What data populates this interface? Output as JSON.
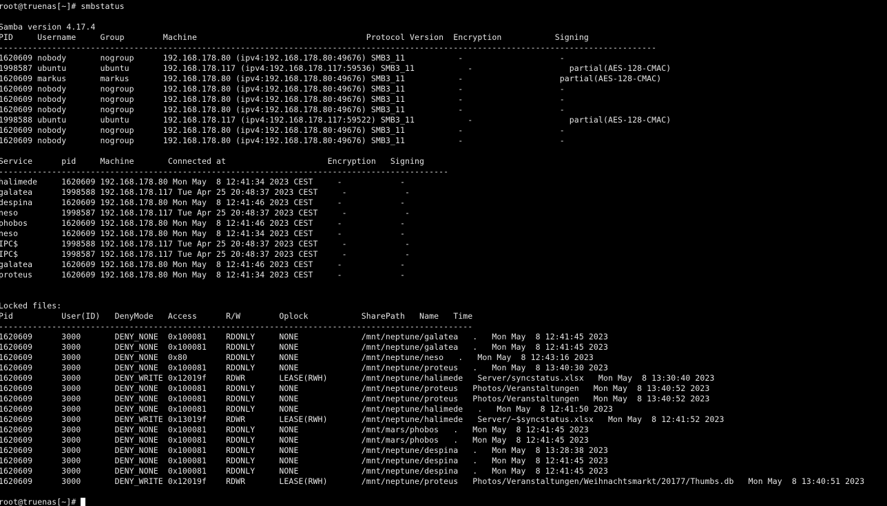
{
  "terminal": {
    "prompt_cmd": "root@truenas[~]# smbstatus",
    "blank": "",
    "version": "Samba version 4.17.4",
    "sessions_header": "PID     Username     Group        Machine                                   Protocol Version  Encryption           Signing",
    "sessions_divider": "----------------------------------------------------------------------------------------------------------------------------------------",
    "sessions": [
      "1620609 nobody       nogroup      192.168.178.80 (ipv4:192.168.178.80:49676) SMB3_11           -                    -",
      "1998587 ubuntu       ubuntu       192.168.178.117 (ipv4:192.168.178.117:59536) SMB3_11           -                    partial(AES-128-CMAC)",
      "1620609 markus       markus       192.168.178.80 (ipv4:192.168.178.80:49676) SMB3_11           -                    partial(AES-128-CMAC)",
      "1620609 nobody       nogroup      192.168.178.80 (ipv4:192.168.178.80:49676) SMB3_11           -                    -",
      "1620609 nobody       nogroup      192.168.178.80 (ipv4:192.168.178.80:49676) SMB3_11           -                    -",
      "1620609 nobody       nogroup      192.168.178.80 (ipv4:192.168.178.80:49676) SMB3_11           -                    -",
      "1998588 ubuntu       ubuntu       192.168.178.117 (ipv4:192.168.178.117:59522) SMB3_11           -                    partial(AES-128-CMAC)",
      "1620609 nobody       nogroup      192.168.178.80 (ipv4:192.168.178.80:49676) SMB3_11           -                    -",
      "1620609 nobody       nogroup      192.168.178.80 (ipv4:192.168.178.80:49676) SMB3_11           -                    -"
    ],
    "services_header": "Service      pid     Machine       Connected at                     Encryption   Signing",
    "services_divider": "---------------------------------------------------------------------------------------------",
    "services": [
      "halimede     1620609 192.168.178.80 Mon May  8 12:41:34 2023 CEST     -            -",
      "galatea      1998588 192.168.178.117 Tue Apr 25 20:48:37 2023 CEST     -            -",
      "despina      1620609 192.168.178.80 Mon May  8 12:41:46 2023 CEST     -            -",
      "neso         1998587 192.168.178.117 Tue Apr 25 20:48:37 2023 CEST     -            -",
      "phobos       1620609 192.168.178.80 Mon May  8 12:41:46 2023 CEST     -            -",
      "neso         1620609 192.168.178.80 Mon May  8 12:41:34 2023 CEST     -            -",
      "IPC$         1998588 192.168.178.117 Tue Apr 25 20:48:37 2023 CEST     -            -",
      "IPC$         1998587 192.168.178.117 Tue Apr 25 20:48:37 2023 CEST     -            -",
      "galatea      1620609 192.168.178.80 Mon May  8 12:41:46 2023 CEST     -            -",
      "proteus      1620609 192.168.178.80 Mon May  8 12:41:34 2023 CEST     -            -"
    ],
    "locked_title": "Locked files:",
    "locked_header": "Pid          User(ID)   DenyMode   Access      R/W        Oplock           SharePath   Name   Time",
    "locked_divider": "--------------------------------------------------------------------------------------------------",
    "locked": [
      "1620609      3000       DENY_NONE  0x100081    RDONLY     NONE             /mnt/neptune/galatea   .   Mon May  8 12:41:45 2023",
      "1620609      3000       DENY_NONE  0x100081    RDONLY     NONE             /mnt/neptune/galatea   .   Mon May  8 12:41:45 2023",
      "1620609      3000       DENY_NONE  0x80        RDONLY     NONE             /mnt/neptune/neso   .   Mon May  8 12:43:16 2023",
      "1620609      3000       DENY_NONE  0x100081    RDONLY     NONE             /mnt/neptune/proteus   .   Mon May  8 13:40:30 2023",
      "1620609      3000       DENY_WRITE 0x12019f    RDWR       LEASE(RWH)       /mnt/neptune/halimede   Server/syncstatus.xlsx   Mon May  8 13:30:40 2023",
      "1620609      3000       DENY_NONE  0x100081    RDONLY     NONE             /mnt/neptune/proteus   Photos/Veranstaltungen   Mon May  8 13:40:52 2023",
      "1620609      3000       DENY_NONE  0x100081    RDONLY     NONE             /mnt/neptune/proteus   Photos/Veranstaltungen   Mon May  8 13:40:52 2023",
      "1620609      3000       DENY_NONE  0x100081    RDONLY     NONE             /mnt/neptune/halimede   .   Mon May  8 12:41:50 2023",
      "1620609      3000       DENY_WRITE 0x13019f    RDWR       LEASE(RWH)       /mnt/neptune/halimede   Server/~$syncstatus.xlsx   Mon May  8 12:41:52 2023",
      "1620609      3000       DENY_NONE  0x100081    RDONLY     NONE             /mnt/mars/phobos   .   Mon May  8 12:41:45 2023",
      "1620609      3000       DENY_NONE  0x100081    RDONLY     NONE             /mnt/mars/phobos   .   Mon May  8 12:41:45 2023",
      "1620609      3000       DENY_NONE  0x100081    RDONLY     NONE             /mnt/neptune/despina   .   Mon May  8 13:28:38 2023",
      "1620609      3000       DENY_NONE  0x100081    RDONLY     NONE             /mnt/neptune/despina   .   Mon May  8 12:41:45 2023",
      "1620609      3000       DENY_NONE  0x100081    RDONLY     NONE             /mnt/neptune/despina   .   Mon May  8 12:41:45 2023",
      "1620609      3000       DENY_WRITE 0x12019f    RDWR       LEASE(RWH)       /mnt/neptune/proteus   Photos/Veranstaltungen/Weihnachtsmarkt/20177/Thumbs.db   Mon May  8 13:40:51 2023"
    ],
    "prompt": "root@truenas[~]# "
  }
}
